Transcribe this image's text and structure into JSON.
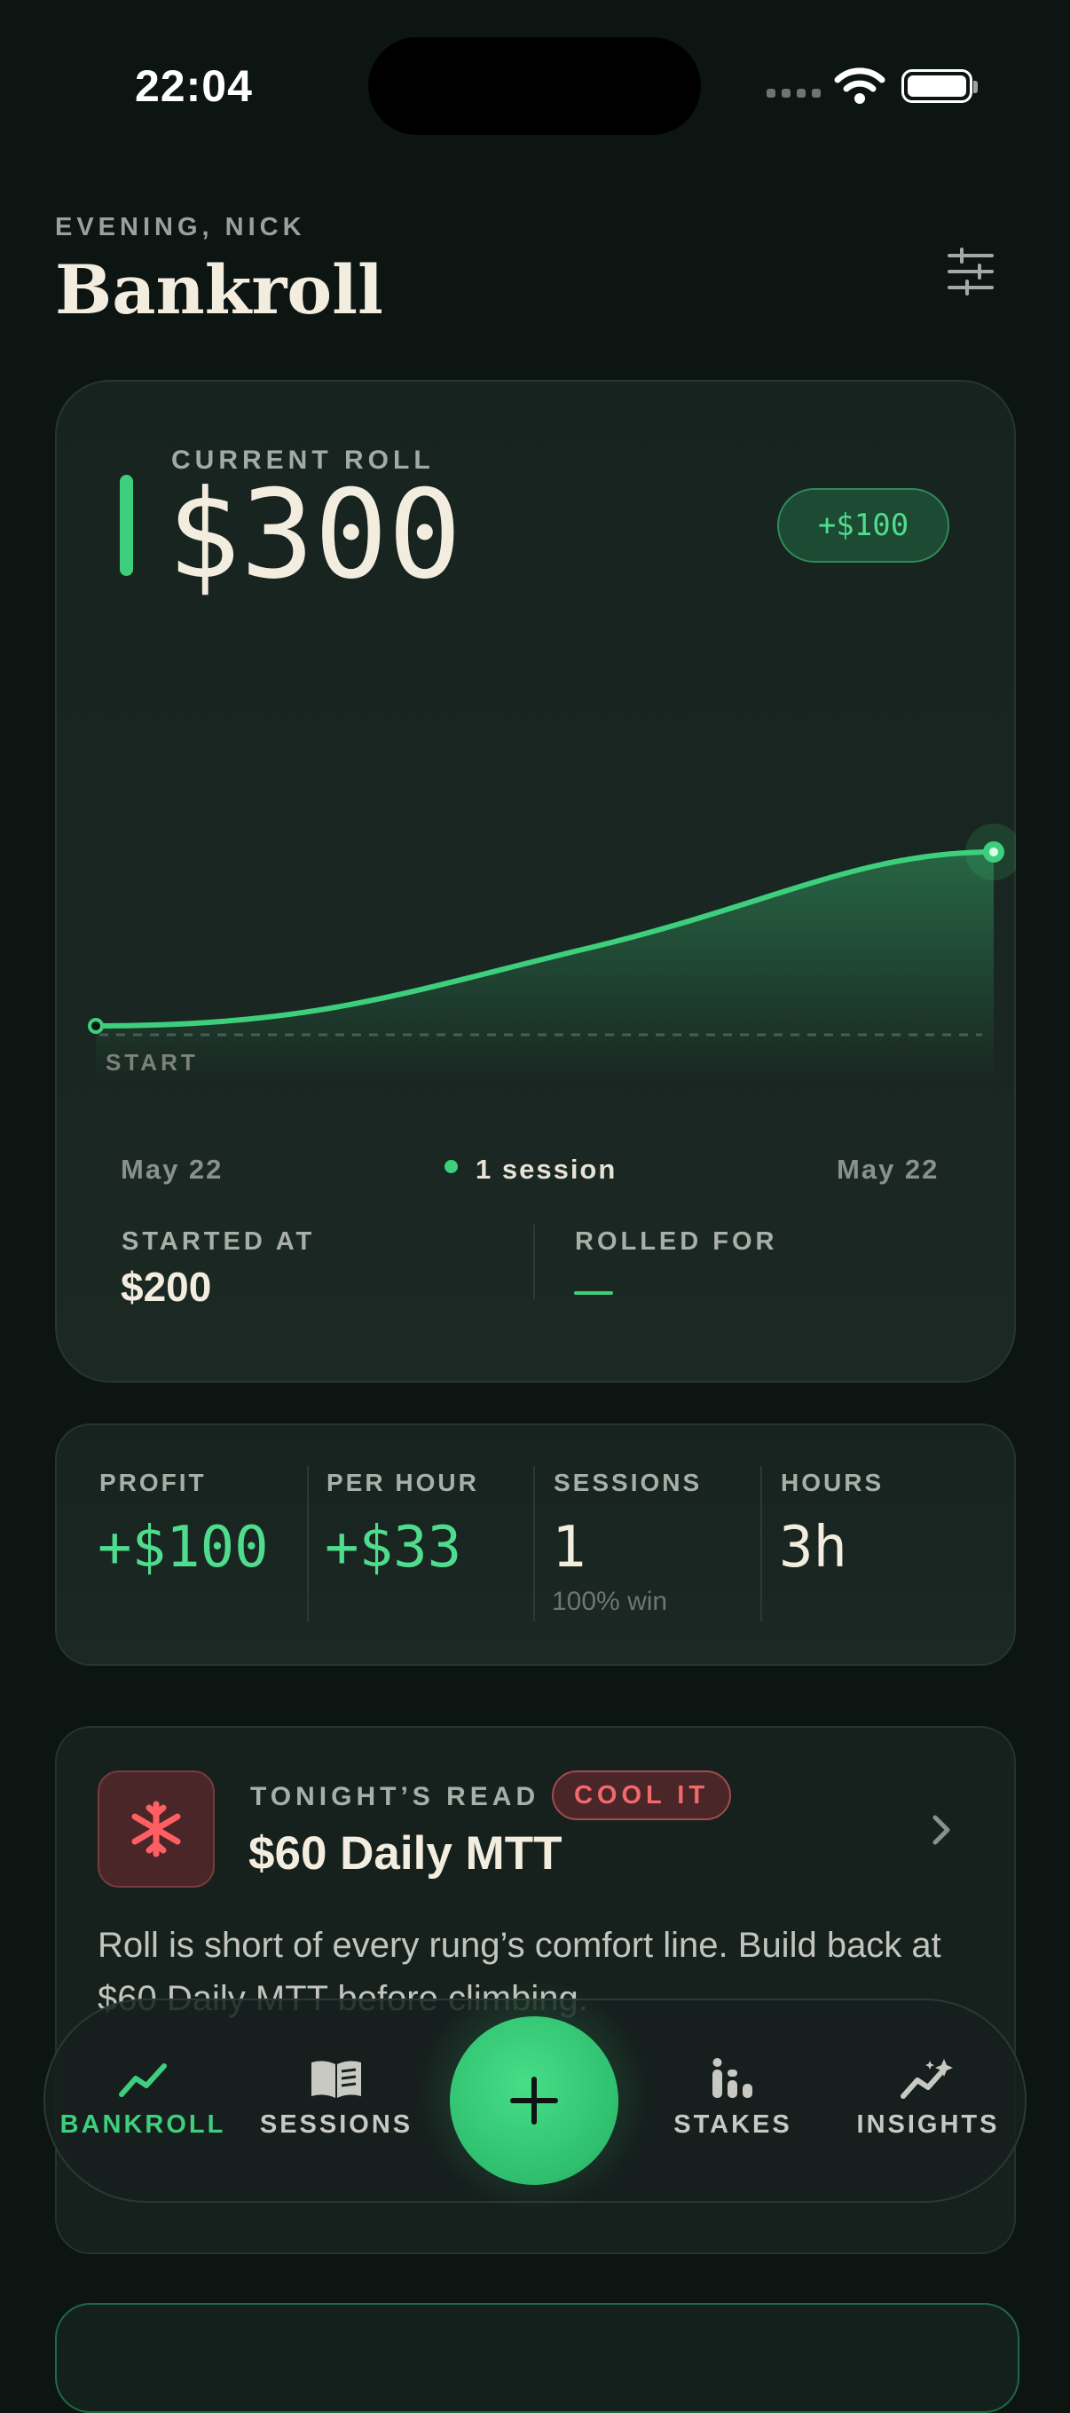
{
  "status_bar": {
    "time": "22:04"
  },
  "header": {
    "greeting": "EVENING, NICK",
    "title": "Bankroll"
  },
  "roll": {
    "label": "CURRENT ROLL",
    "value": "$300",
    "delta": "+$100",
    "start_label": "START",
    "date_start": "May 22",
    "date_end": "May 22",
    "session_count": "1 session",
    "started_at_label": "STARTED AT",
    "started_at_value": "$200",
    "rolled_for_label": "ROLLED FOR",
    "accent_color": "#3ecf7d"
  },
  "chart_data": {
    "type": "area",
    "x": [
      "start",
      "end"
    ],
    "series": [
      {
        "values": [
          200,
          300
        ]
      }
    ],
    "baseline": 200
  },
  "stats": [
    {
      "label": "PROFIT",
      "value": "+$100",
      "tone": "green"
    },
    {
      "label": "PER HOUR",
      "value": "+$33",
      "tone": "green"
    },
    {
      "label": "SESSIONS",
      "value": "1",
      "sub": "100% win",
      "tone": "cream"
    },
    {
      "label": "HOURS",
      "value": "3h",
      "tone": "cream"
    }
  ],
  "read": {
    "label": "TONIGHT’S READ",
    "badge": "COOL IT",
    "title": "$60 Daily MTT",
    "body": "Roll is short of every rung’s comfort line. Build back at $60 Daily MTT before climbing.",
    "icon": "snowflake-icon"
  },
  "tabs": [
    {
      "label": "BANKROLL",
      "icon": "trend-icon",
      "active": true
    },
    {
      "label": "SESSIONS",
      "icon": "book-icon",
      "active": false
    },
    {
      "label": "STAKES",
      "icon": "stakes-icon",
      "active": false
    },
    {
      "label": "INSIGHTS",
      "icon": "sparkle-chart-icon",
      "active": false
    }
  ]
}
